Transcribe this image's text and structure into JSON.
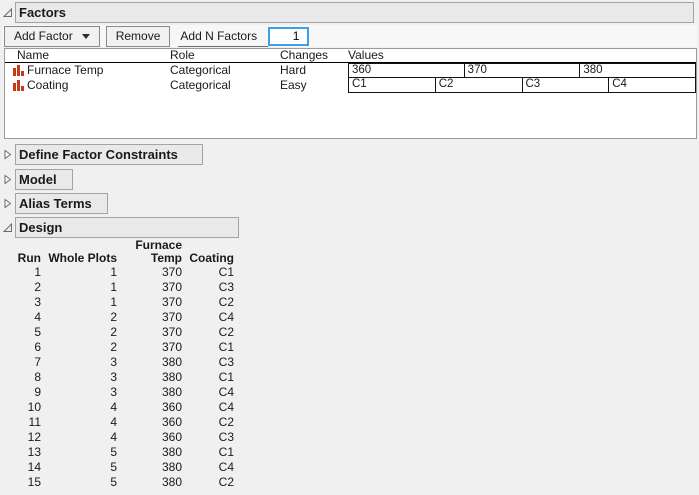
{
  "factors": {
    "title": "Factors",
    "toolbar": {
      "add_factor": "Add Factor",
      "remove": "Remove",
      "add_n_factors": "Add N Factors",
      "n_value": "1"
    },
    "columns": {
      "name": "Name",
      "role": "Role",
      "changes": "Changes",
      "values": "Values"
    },
    "rows": [
      {
        "icon": "categorical-bars-icon",
        "name": "Furnace Temp",
        "role": "Categorical",
        "changes": "Hard",
        "values": [
          "360",
          "370",
          "380"
        ]
      },
      {
        "icon": "categorical-bars-icon",
        "name": "Coating",
        "role": "Categorical",
        "changes": "Easy",
        "values": [
          "C1",
          "C2",
          "C3",
          "C4"
        ]
      }
    ]
  },
  "outlines": {
    "define_factor_constraints": "Define Factor Constraints",
    "model": "Model",
    "alias_terms": "Alias Terms",
    "design": "Design"
  },
  "design_table": {
    "header_top": [
      "",
      "",
      "Furnace",
      ""
    ],
    "header": [
      "Run",
      "Whole Plots",
      "Temp",
      "Coating"
    ],
    "rows": [
      [
        "1",
        "1",
        "370",
        "C1"
      ],
      [
        "2",
        "1",
        "370",
        "C3"
      ],
      [
        "3",
        "1",
        "370",
        "C2"
      ],
      [
        "4",
        "2",
        "370",
        "C4"
      ],
      [
        "5",
        "2",
        "370",
        "C2"
      ],
      [
        "6",
        "2",
        "370",
        "C1"
      ],
      [
        "7",
        "3",
        "380",
        "C3"
      ],
      [
        "8",
        "3",
        "380",
        "C1"
      ],
      [
        "9",
        "3",
        "380",
        "C4"
      ],
      [
        "10",
        "4",
        "360",
        "C4"
      ],
      [
        "11",
        "4",
        "360",
        "C2"
      ],
      [
        "12",
        "4",
        "360",
        "C3"
      ],
      [
        "13",
        "5",
        "380",
        "C1"
      ],
      [
        "14",
        "5",
        "380",
        "C4"
      ],
      [
        "15",
        "5",
        "380",
        "C2"
      ]
    ]
  },
  "colors": {
    "accent_blue": "#3f9ee8",
    "factor_icon_red": "#c23b1d",
    "header_box_bg": "#e9e9e9",
    "page_bg": "#f0f0f0"
  }
}
